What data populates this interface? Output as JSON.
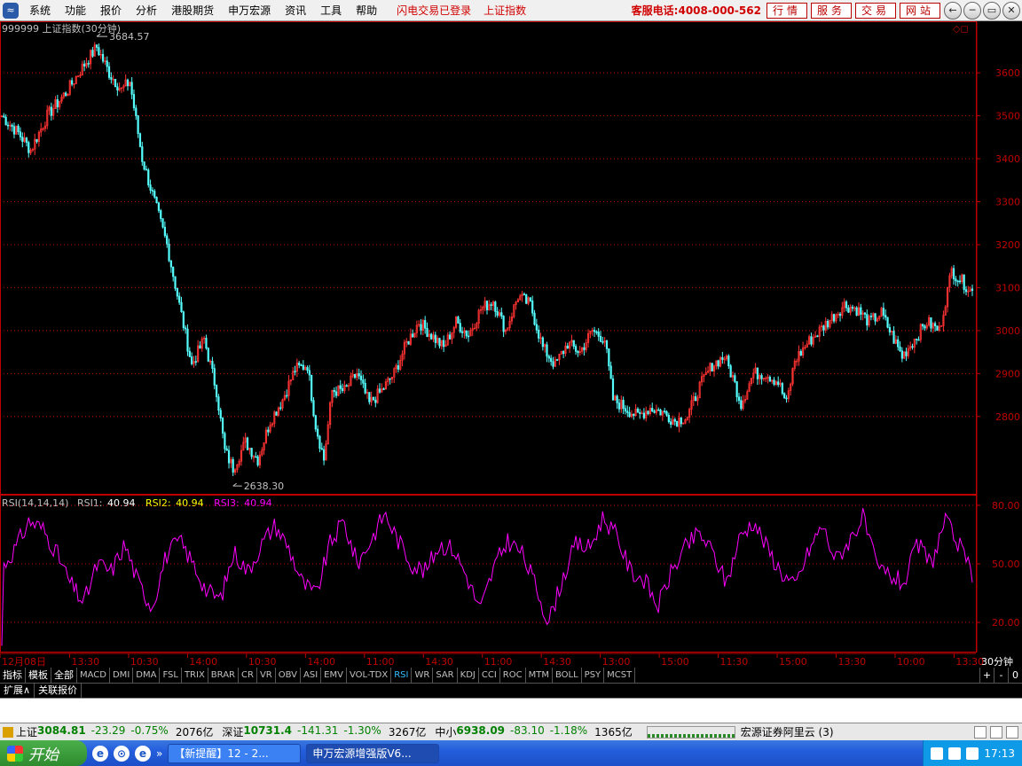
{
  "menubar": {
    "logo": "≈",
    "items": [
      "系统",
      "功能",
      "报价",
      "分析",
      "港股期货",
      "申万宏源",
      "资讯",
      "工具",
      "帮助"
    ],
    "status_login": "闪电交易已登录",
    "status_index": "上证指数",
    "hotline": "客服电话:4008-000-562",
    "nav_buttons": [
      "行情",
      "服务",
      "交易",
      "网站"
    ],
    "win_buttons": [
      "←",
      "─",
      "▭",
      "✕"
    ]
  },
  "chart_header": {
    "title": "999999 上证指数(30分钟)",
    "high_label": "3684.57",
    "low_label": "2638.30"
  },
  "indicator_header": {
    "name": "RSI(14,14,14)",
    "rsi1_label": "RSI1:",
    "rsi1_value": "40.94",
    "rsi2_label": "RSI2:",
    "rsi2_value": "40.94",
    "rsi3_label": "RSI3:",
    "rsi3_value": "40.94"
  },
  "colors": {
    "up": "#ff3333",
    "down": "#55ffff",
    "axis": "#c00000",
    "rsi": "#ff00ff",
    "rsi2": "#ffff00",
    "grid": "#c00000"
  },
  "chart_data": {
    "type": "candlestick",
    "price_axis": {
      "ticks": [
        2800,
        2900,
        3000,
        3100,
        3200,
        3300,
        3400,
        3500,
        3600
      ],
      "range": [
        2620,
        3720
      ]
    },
    "rsi_axis": {
      "ticks": [
        "20.00",
        "50.00",
        "80.00"
      ],
      "range": [
        5,
        85
      ]
    },
    "time_labels": [
      "12月08日",
      "13:30",
      "10:30",
      "14:00",
      "10:30",
      "14:00",
      "11:00",
      "14:30",
      "11:00",
      "14:30",
      "13:00",
      "15:00",
      "11:30",
      "15:00",
      "13:30",
      "10:00",
      "13:30"
    ],
    "period_label": "30分钟",
    "price_keypoints": [
      [
        0,
        3500
      ],
      [
        8,
        3460
      ],
      [
        14,
        3420
      ],
      [
        22,
        3500
      ],
      [
        32,
        3560
      ],
      [
        40,
        3620
      ],
      [
        46,
        3660
      ],
      [
        52,
        3600
      ],
      [
        58,
        3560
      ],
      [
        62,
        3580
      ],
      [
        68,
        3400
      ],
      [
        74,
        3300
      ],
      [
        80,
        3200
      ],
      [
        86,
        3060
      ],
      [
        92,
        2920
      ],
      [
        98,
        2980
      ],
      [
        104,
        2860
      ],
      [
        108,
        2720
      ],
      [
        112,
        2680
      ],
      [
        118,
        2740
      ],
      [
        124,
        2700
      ],
      [
        130,
        2790
      ],
      [
        136,
        2840
      ],
      [
        142,
        2910
      ],
      [
        148,
        2920
      ],
      [
        152,
        2780
      ],
      [
        156,
        2700
      ],
      [
        160,
        2860
      ],
      [
        166,
        2860
      ],
      [
        172,
        2900
      ],
      [
        178,
        2830
      ],
      [
        184,
        2860
      ],
      [
        190,
        2900
      ],
      [
        196,
        2970
      ],
      [
        202,
        3020
      ],
      [
        208,
        2990
      ],
      [
        214,
        2960
      ],
      [
        220,
        3020
      ],
      [
        226,
        2990
      ],
      [
        232,
        3050
      ],
      [
        238,
        3070
      ],
      [
        244,
        3000
      ],
      [
        250,
        3080
      ],
      [
        256,
        3060
      ],
      [
        262,
        2960
      ],
      [
        268,
        2920
      ],
      [
        274,
        2970
      ],
      [
        280,
        2950
      ],
      [
        286,
        3000
      ],
      [
        292,
        2980
      ],
      [
        296,
        2840
      ],
      [
        302,
        2820
      ],
      [
        308,
        2800
      ],
      [
        314,
        2820
      ],
      [
        320,
        2810
      ],
      [
        326,
        2790
      ],
      [
        332,
        2800
      ],
      [
        338,
        2870
      ],
      [
        344,
        2920
      ],
      [
        350,
        2940
      ],
      [
        354,
        2890
      ],
      [
        358,
        2830
      ],
      [
        364,
        2900
      ],
      [
        370,
        2900
      ],
      [
        376,
        2880
      ],
      [
        380,
        2830
      ],
      [
        384,
        2930
      ],
      [
        390,
        2970
      ],
      [
        396,
        3000
      ],
      [
        402,
        3030
      ],
      [
        408,
        3060
      ],
      [
        414,
        3050
      ],
      [
        420,
        3020
      ],
      [
        426,
        3040
      ],
      [
        430,
        3000
      ],
      [
        436,
        2940
      ],
      [
        442,
        2980
      ],
      [
        448,
        3020
      ],
      [
        454,
        3000
      ],
      [
        460,
        3140
      ],
      [
        466,
        3110
      ],
      [
        470,
        3090
      ]
    ],
    "price_points": 471,
    "rsi_seed_values": [
      48,
      58,
      72,
      68,
      56,
      40,
      30,
      50,
      46,
      60,
      40,
      28,
      54,
      62,
      50,
      36,
      32,
      56,
      46,
      60,
      70,
      58,
      40,
      34,
      60,
      72,
      50,
      62,
      76,
      62,
      50,
      46,
      60,
      58,
      44,
      26,
      48,
      62,
      56,
      40,
      20,
      42,
      60,
      58,
      74,
      64,
      46,
      42,
      28,
      46,
      58,
      66,
      56,
      40,
      64,
      72,
      58,
      46,
      38,
      56,
      70,
      52,
      62,
      74,
      48,
      44,
      40,
      60,
      50,
      72,
      60,
      44
    ],
    "rsi_points": 471
  },
  "indicator_tabs": {
    "categories": [
      "指标",
      "模板",
      "全部"
    ],
    "items": [
      "MACD",
      "DMI",
      "DMA",
      "FSL",
      "TRIX",
      "BRAR",
      "CR",
      "VR",
      "OBV",
      "ASI",
      "EMV",
      "VOL-TDX",
      "RSI",
      "WR",
      "SAR",
      "KDJ",
      "CCI",
      "ROC",
      "MTM",
      "BOLL",
      "PSY",
      "MCST"
    ],
    "active": "RSI",
    "zoom": [
      "+",
      "-",
      "0"
    ]
  },
  "sub_tabs": [
    "扩展∧",
    "关联报价"
  ],
  "ticker": {
    "groups": [
      {
        "name": "上证",
        "value": "3084.81",
        "change": "-23.29",
        "pct": "-0.75%",
        "volume": "2076亿"
      },
      {
        "name": "深证",
        "value": "10731.4",
        "change": "-141.31",
        "pct": "-1.30%",
        "volume": "3267亿"
      },
      {
        "name": "中小",
        "value": "6938.09",
        "change": "-83.10",
        "pct": "-1.18%",
        "volume": "1365亿"
      }
    ],
    "broker": "宏源证券阿里云 (3)"
  },
  "taskbar": {
    "start_label": "开始",
    "quicklaunch": [
      "e",
      "⊙",
      "e"
    ],
    "more": "»",
    "tasks": [
      "【新提醒】12 - 2...",
      "申万宏源增强版V6..."
    ],
    "clock": "17:13"
  }
}
